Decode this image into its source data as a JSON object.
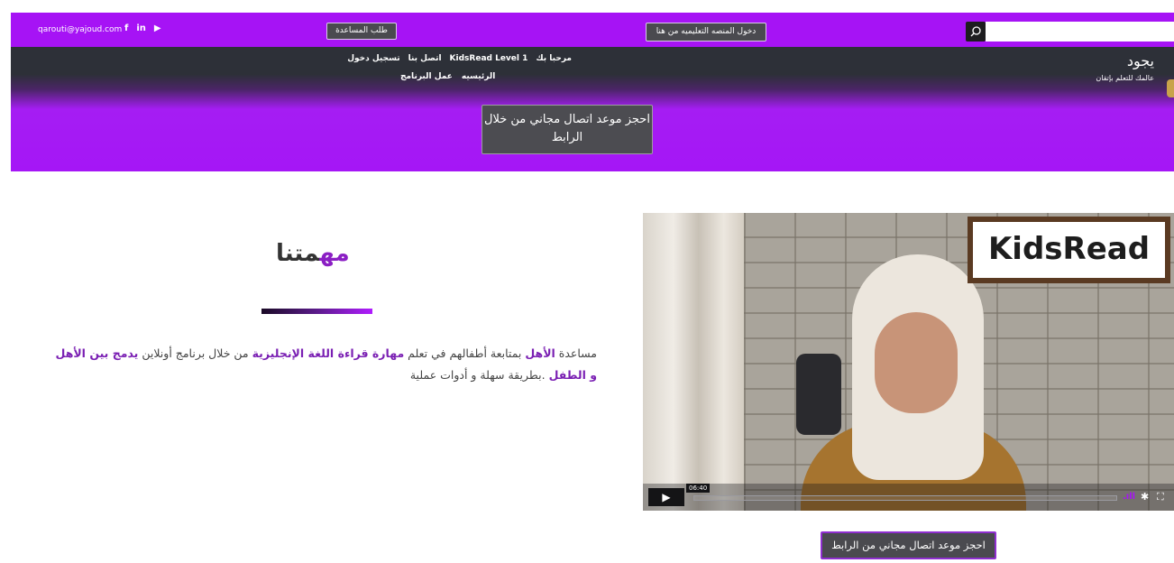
{
  "topbar": {
    "email": "qarouti@yajoud.com",
    "social": [
      {
        "icon": "facebook-icon",
        "glyph": "f"
      },
      {
        "icon": "linkedin-icon",
        "glyph": "in"
      },
      {
        "icon": "youtube-icon",
        "glyph": "▶"
      }
    ],
    "help_button": "طلب المساعدة",
    "platform_button": "دخول المنصه التعليميه من هنا",
    "search": {
      "icon": "search-icon",
      "placeholder": ""
    }
  },
  "brand": {
    "title": "يجود",
    "subtitle": "عالمك للتعلم بإتقان"
  },
  "nav": {
    "row1": [
      "مرحبا بك",
      "KidsRead Level 1",
      "اتصل بنا",
      "تسجيل دخول"
    ],
    "row2": [
      "الرئيسيه",
      "عمل البرنامج"
    ]
  },
  "hero": {
    "cta": "احجز موعد اتصال مجاني من خلال الرابط"
  },
  "mission": {
    "title_dark": "متنا",
    "title_accent": "مه",
    "text": {
      "p1": "مساعدة ",
      "p2": "الأهل",
      "p3": " بمتابعة أطفالهم في تعلم ",
      "p4": "مهارة قراءة اللغة الإنجليزية",
      "p5": " من خلال برنامج أونلاين ",
      "p6": "يدمج بين الأهل و الطفل",
      "p7": " .بطريقة سهلة و أدوات عملية"
    }
  },
  "video": {
    "sign": "KidsRead",
    "time": "06:40",
    "play_icon": "play-icon",
    "volume_icon": "volume-icon",
    "settings_icon": "gear-icon",
    "fullscreen_icon": "fullscreen-icon"
  },
  "bottom": {
    "cta": "احجز موعد اتصال مجاني من الرابط"
  },
  "colors": {
    "accent": "#a613f5",
    "nav_dark": "#2d3038",
    "button_dark": "#4a4a4f",
    "mission_accent": "#7a1fb3"
  }
}
